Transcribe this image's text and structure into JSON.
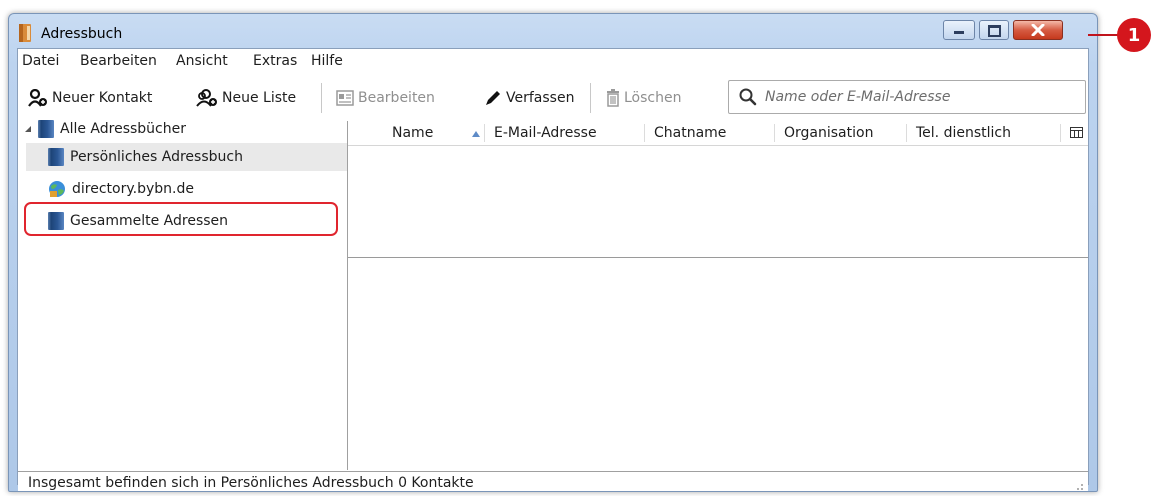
{
  "window": {
    "title": "Adressbuch"
  },
  "menu": [
    {
      "label": "Datei"
    },
    {
      "label": "Bearbeiten"
    },
    {
      "label": "Ansicht"
    },
    {
      "label": "Extras"
    },
    {
      "label": "Hilfe"
    }
  ],
  "toolbar": {
    "new_contact": "Neuer Kontakt",
    "new_list": "Neue Liste",
    "edit": "Bearbeiten",
    "compose": "Verfassen",
    "delete": "Löschen",
    "search_placeholder": "Name oder E-Mail-Adresse"
  },
  "tree": {
    "root": "Alle Adressbücher",
    "items": [
      {
        "label": "Persönliches Adressbuch",
        "icon": "book-icon",
        "selected": true
      },
      {
        "label": "directory.bybn.de",
        "icon": "globe-icon",
        "selected": false
      },
      {
        "label": "Gesammelte Adressen",
        "icon": "book-icon",
        "selected": false
      }
    ]
  },
  "columns": [
    "Name",
    "E-Mail-Adresse",
    "Chatname",
    "Organisation",
    "Tel. dienstlich"
  ],
  "status": "Insgesamt befinden sich in Persönliches Adressbuch 0 Kontakte",
  "callout": {
    "number": "1"
  },
  "colors": {
    "highlight": "#e0252e",
    "callout": "#d4161d",
    "close_button": "#c5391d"
  }
}
